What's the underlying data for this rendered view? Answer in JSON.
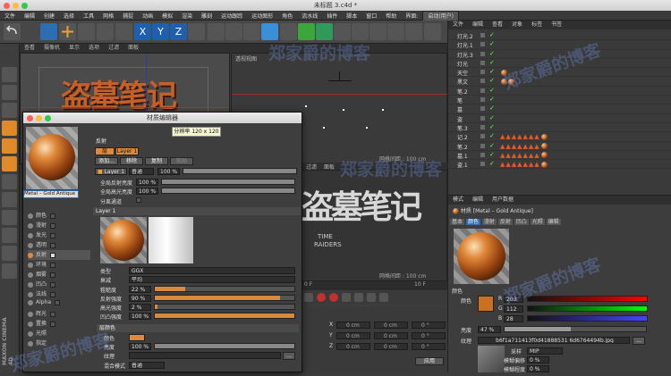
{
  "window": {
    "title": "未标题 3.c4d *"
  },
  "menu": [
    "文件",
    "编辑",
    "创建",
    "选择",
    "工具",
    "网格",
    "捕捉",
    "动画",
    "模拟",
    "渲染",
    "雕刻",
    "运动跟踪",
    "运动图形",
    "角色",
    "流水线",
    "插件",
    "脚本",
    "窗口",
    "帮助",
    "界面:",
    "启动(用户)"
  ],
  "viewport": {
    "menu": [
      "查看",
      "摄像机",
      "显示",
      "选项",
      "过滤",
      "面板"
    ],
    "label": "透视视图",
    "grid_label": "网格间距 : 100 cm",
    "grid_label_2": "网格间距 : 100 cm",
    "menu_top": [
      "过滤",
      "面板"
    ]
  },
  "artwork": {
    "logo_text": "盗墓笔记",
    "subtitle_1": "TIME",
    "subtitle_2": "RAIDERS"
  },
  "object_manager": {
    "menu": [
      "文件",
      "编辑",
      "查看",
      "对象",
      "标签",
      "书签"
    ],
    "rows": [
      {
        "name": "灯光.2"
      },
      {
        "name": "灯光.1"
      },
      {
        "name": "灯光.3"
      },
      {
        "name": "灯光"
      },
      {
        "name": "天空"
      },
      {
        "name": "黑文"
      },
      {
        "name": "笔.2"
      },
      {
        "name": "笔"
      },
      {
        "name": "墓"
      },
      {
        "name": "盗"
      },
      {
        "name": "笔.3"
      },
      {
        "name": "记.2"
      },
      {
        "name": "笔.2"
      },
      {
        "name": "墓.1"
      },
      {
        "name": "盗.1"
      }
    ]
  },
  "attr_manager": {
    "menu": [
      "模式",
      "编辑",
      "用户数据"
    ],
    "title": "材质 [Metal – Gold Antique]",
    "tabs": [
      "基本",
      "颜色",
      "漫射",
      "反射",
      "凹凸",
      "光照",
      "编辑"
    ],
    "section": "颜色",
    "color_label": "颜色",
    "r": "203",
    "g": "112",
    "b": "28",
    "brightness_label": "亮度",
    "brightness": "47 %",
    "texture_label": "纹理",
    "texture_file": "b6f1a711413f0d41888531 6d6764494b.jpg",
    "sample_label": "采样",
    "sample_value": "MIP",
    "blur_offset_label": "模糊偏移",
    "blur_offset": "0 %",
    "blur_scale_label": "模糊程度",
    "blur_scale": "0 %",
    "swatch": "#cb701c"
  },
  "material_editor": {
    "title": "材质编辑器",
    "tooltip": "分辨率 120 x 120",
    "material_name": "Metal – Gold Antique",
    "channels": [
      {
        "name": "颜色",
        "checked": true
      },
      {
        "name": "漫射",
        "checked": false
      },
      {
        "name": "发光",
        "checked": false
      },
      {
        "name": "透明",
        "checked": false
      },
      {
        "name": "反射",
        "checked": true
      },
      {
        "name": "环境",
        "checked": false
      },
      {
        "name": "烟雾",
        "checked": false
      },
      {
        "name": "凹凸",
        "checked": true
      },
      {
        "name": "法线",
        "checked": false
      },
      {
        "name": "Alpha",
        "checked": false
      },
      {
        "name": "辉光",
        "checked": false
      },
      {
        "name": "置换",
        "checked": false
      },
      {
        "name": "光照",
        "checked": false
      },
      {
        "name": "指定",
        "checked": false
      }
    ],
    "section": "反射",
    "tabs": [
      "层",
      "Layer 1"
    ],
    "buttons": [
      "添加...",
      "移除",
      "复制",
      "粘贴"
    ],
    "layer_name": "Layer 1",
    "blend_mode": "普通",
    "blend_value": "100 %",
    "global_reflect_label": "全局反射亮度",
    "global_reflect": "100 %",
    "global_spec_label": "全局高光亮度",
    "global_spec": "100 %",
    "separate_label": "分离通道",
    "layer_header": "Layer 1",
    "type_label": "类型",
    "type_value": "GGX",
    "atten_label": "衰减",
    "atten_value": "平均",
    "rough_label": "粗糙度",
    "rough_value": "22 %",
    "rough": 0.22,
    "reflect_str_label": "反射强度",
    "reflect_str_value": "90 %",
    "reflect_str": 0.9,
    "spec_label": "高光强度",
    "spec_value": "2 %",
    "spec": 0.02,
    "bump_label": "凹凸强度",
    "bump_value": "100 %",
    "bump": 1.0,
    "layer_color_header": "层颜色",
    "color_label": "颜色",
    "bright_label": "亮度",
    "bright_value": "100 %",
    "tex_label": "纹理",
    "mix_label": "混合模式",
    "mix_value": "普通"
  },
  "coords": {
    "rows": [
      {
        "a": "X",
        "av": "0 cm",
        "b": "X",
        "bv": "0 cm",
        "c": "H",
        "cv": "0 °"
      },
      {
        "a": "Y",
        "av": "0 cm",
        "b": "Y",
        "bv": "0 cm",
        "c": "P",
        "cv": "0 °"
      },
      {
        "a": "Z",
        "av": "0 cm",
        "b": "Z",
        "bv": "0 cm",
        "c": "B",
        "cv": "0 °"
      }
    ],
    "time": "0 F",
    "time2": "10 F",
    "apply": "应用"
  },
  "watermark": "郑家爵的博客",
  "logo_side": "MAXON CINEMA 4D"
}
